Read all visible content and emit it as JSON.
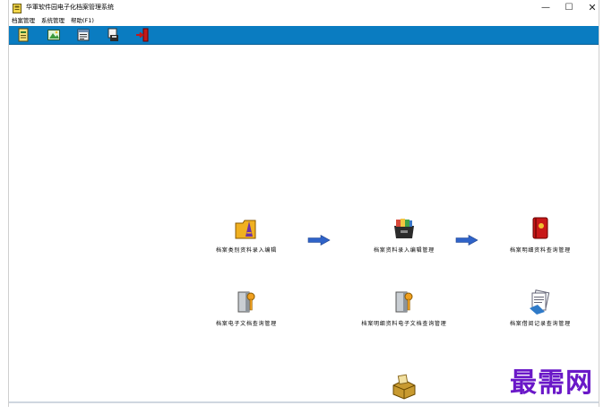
{
  "window": {
    "title": "华軍软件园电子化档案管理系统",
    "controls": {
      "minimize": "—",
      "maximize": "☐",
      "close": "✕"
    }
  },
  "menu": [
    "档案管理",
    "系统管理",
    "帮助(F1)"
  ],
  "toolbar": {
    "background": "#0a7cc1",
    "buttons": [
      {
        "icon": "document-icon"
      },
      {
        "icon": "image-icon"
      },
      {
        "icon": "records-icon"
      },
      {
        "icon": "save-disk-icon"
      },
      {
        "icon": "exit-door-icon"
      }
    ]
  },
  "modules": [
    {
      "label": "档案类别资料录入编辑",
      "icon": "folder-icon"
    },
    {
      "label": "档案资料录入编辑管理",
      "icon": "file-box-icon"
    },
    {
      "label": "档案明细资料查询管理",
      "icon": "red-book-icon"
    },
    {
      "label": "档案电子文档查询管理",
      "icon": "key-document-icon"
    },
    {
      "label": "档案明细资料电子文档查询管理",
      "icon": "key-document-icon"
    },
    {
      "label": "档案借阅记录查询管理",
      "icon": "documents-stack-icon"
    },
    {
      "label": "",
      "icon": "archive-box-icon"
    }
  ],
  "watermark": "最需网"
}
